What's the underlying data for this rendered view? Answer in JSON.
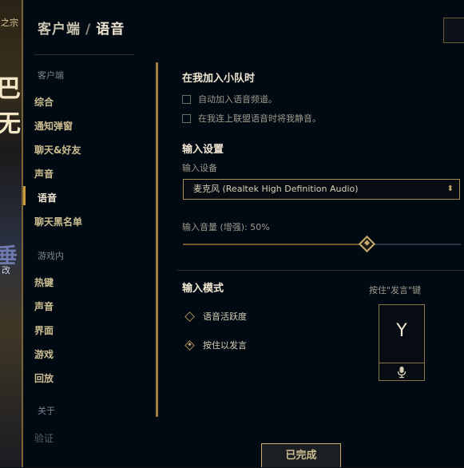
{
  "background": {
    "snippet_top": "之宗",
    "snippet_big": "巴无",
    "snippet_mid": "垂",
    "snippet_small": "改"
  },
  "header": {
    "section": "客户端",
    "separator": "/",
    "current": "语音"
  },
  "sidebar": {
    "client_header": "客户端",
    "client_items": [
      {
        "label": "综合"
      },
      {
        "label": "通知弹窗"
      },
      {
        "label": "聊天&好友"
      },
      {
        "label": "声音"
      },
      {
        "label": "语音",
        "active": true
      },
      {
        "label": "聊天黑名单"
      }
    ],
    "game_header": "游戏内",
    "game_items": [
      {
        "label": "热键"
      },
      {
        "label": "声音"
      },
      {
        "label": "界面"
      },
      {
        "label": "游戏"
      },
      {
        "label": "回放"
      }
    ],
    "about": "关于",
    "verify": "验证"
  },
  "party": {
    "title": "在我加入小队时",
    "auto_join": "自动加入语音频道。",
    "mute_self": "在我连上联盟语音时将我静音。"
  },
  "input": {
    "title": "输入设置",
    "device_label": "输入设备",
    "device_value": "麦克风 (Realtek High Definition Audio)",
    "volume_label": "输入音量 (增强): 50%",
    "volume_percent": 50
  },
  "mode": {
    "title": "输入模式",
    "voice_activity": "语音活跃度",
    "push_to_talk": "按住以发言",
    "selected": "push_to_talk",
    "ptt_key_label": "按住\"发言\"键",
    "ptt_key": "Y"
  },
  "footer": {
    "done": "已完成"
  },
  "colors": {
    "gold": "#c8aa6e",
    "bg": "#010a13",
    "text": "#f0e6d2"
  }
}
